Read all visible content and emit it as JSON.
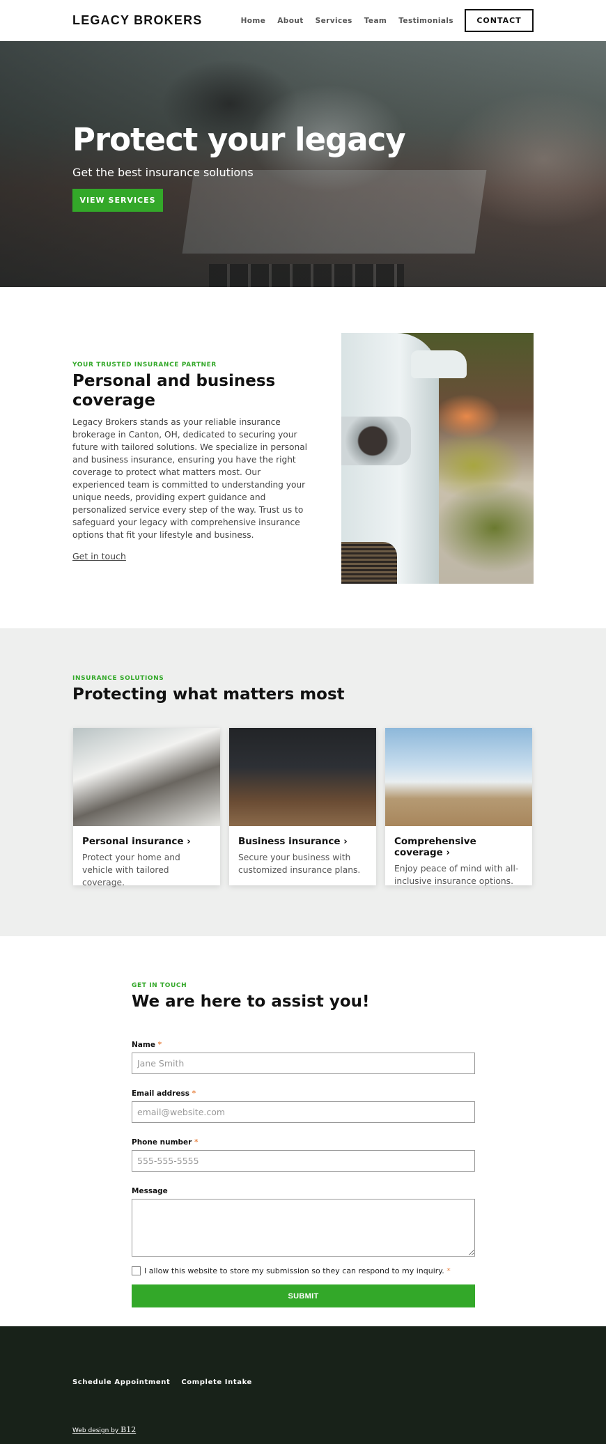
{
  "header": {
    "logo": "LEGACY BROKERS",
    "nav": [
      "Home",
      "About",
      "Services",
      "Team",
      "Testimonials"
    ],
    "contact_label": "CONTACT"
  },
  "hero": {
    "title": "Protect your legacy",
    "subtitle": "Get the best insurance solutions",
    "cta_label": "VIEW SERVICES"
  },
  "about": {
    "eyebrow": "YOUR TRUSTED INSURANCE PARTNER",
    "title": "Personal and business coverage",
    "body": "Legacy Brokers stands as your reliable insurance brokerage in Canton, OH, dedicated to securing your future with tailored solutions. We specialize in personal and business insurance, ensuring you have the right coverage to protect what matters most. Our experienced team is committed to understanding your unique needs, providing expert guidance and personalized service every step of the way. Trust us to safeguard your legacy with comprehensive insurance options that fit your lifestyle and business.",
    "link_label": "Get in touch"
  },
  "services": {
    "eyebrow": "INSURANCE SOLUTIONS",
    "title": "Protecting what matters most",
    "cards": [
      {
        "title": "Personal insurance",
        "desc": "Protect your home and vehicle with tailored coverage."
      },
      {
        "title": "Business insurance",
        "desc": "Secure your business with customized insurance plans."
      },
      {
        "title": "Comprehensive coverage",
        "desc": "Enjoy peace of mind with all-inclusive insurance options."
      }
    ],
    "chevron": "›"
  },
  "contact": {
    "eyebrow": "GET IN TOUCH",
    "title": "We are here to assist you!",
    "fields": {
      "name": {
        "label": "Name",
        "placeholder": "Jane Smith",
        "required_mark": "*"
      },
      "email": {
        "label": "Email address",
        "placeholder": "email@website.com",
        "required_mark": "*"
      },
      "phone": {
        "label": "Phone number",
        "placeholder": "555-555-5555",
        "required_mark": "*"
      },
      "message": {
        "label": "Message",
        "placeholder": ""
      }
    },
    "consent_label": "I allow this website to store my submission so they can respond to my inquiry.",
    "consent_required_mark": "*",
    "submit_label": "SUBMIT"
  },
  "footer": {
    "links": [
      "Schedule Appointment",
      "Complete Intake"
    ],
    "credit_prefix": "Web design by",
    "credit_brand": "B12"
  },
  "colors": {
    "accent": "#33a829",
    "footer_bg": "#182219",
    "section_gray": "#eeefee",
    "required": "#e8884a"
  }
}
